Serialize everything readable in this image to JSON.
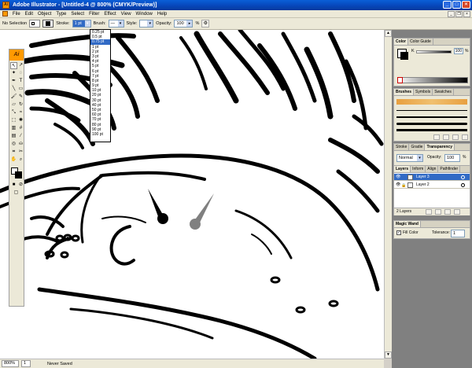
{
  "app": {
    "title": "Adobe Illustrator - [Untitled-4 @ 800% (CMYK/Preview)]",
    "logo_text": "Ai"
  },
  "menu": [
    "File",
    "Edit",
    "Object",
    "Type",
    "Select",
    "Filter",
    "Effect",
    "View",
    "Window",
    "Help"
  ],
  "control_bar": {
    "selection": "No Selection",
    "stroke_label": "Stroke:",
    "stroke_weight": "1 pt",
    "brush_label": "Brush:",
    "style_label": "Style:",
    "opacity_label": "Opacity:",
    "opacity_value": "100",
    "opacity_unit": "%"
  },
  "stroke_weights": [
    "0.25 pt",
    "0.5 pt",
    "0.75 pt",
    "1 pt",
    "2 pt",
    "3 pt",
    "4 pt",
    "5 pt",
    "6 pt",
    "7 pt",
    "8 pt",
    "9 pt",
    "10 pt",
    "20 pt",
    "30 pt",
    "40 pt",
    "50 pt",
    "60 pt",
    "70 pt",
    "80 pt",
    "90 pt",
    "100 pt"
  ],
  "stroke_weight_highlighted": "0.75 pt",
  "color_panel": {
    "tabs": [
      "Color",
      "Color Guide"
    ],
    "channel": "K",
    "value": "100",
    "unit": "%"
  },
  "brushes_panel": {
    "tabs": [
      "Brushes",
      "Symbols",
      "Swatches"
    ]
  },
  "stroke_panel": {
    "tabs": [
      "Stroke",
      "Gradie",
      "Transparency"
    ],
    "mode": "Normal",
    "opacity_label": "Opacity:",
    "opacity_value": "100",
    "opacity_unit": "%"
  },
  "layers_panel": {
    "tabs": [
      "Layers",
      "Inform",
      "Align",
      "Pathfinder"
    ],
    "layers": [
      {
        "name": "Layer 3",
        "active": true
      },
      {
        "name": "Layer 2",
        "active": false
      }
    ],
    "count": "2 Layers"
  },
  "magic_wand_panel": {
    "tab": "Magic Wand",
    "fill_color_label": "Fill Color",
    "tolerance_label": "Tolerance:",
    "tolerance_value": "1"
  },
  "status": {
    "zoom": "800%",
    "page": "1",
    "info": "Never Saved"
  },
  "colors": {
    "titlebar": "#0745b8",
    "highlight": "#316ac5",
    "illustrator_orange": "#ff9a00",
    "annotation_gray": "#808080"
  }
}
